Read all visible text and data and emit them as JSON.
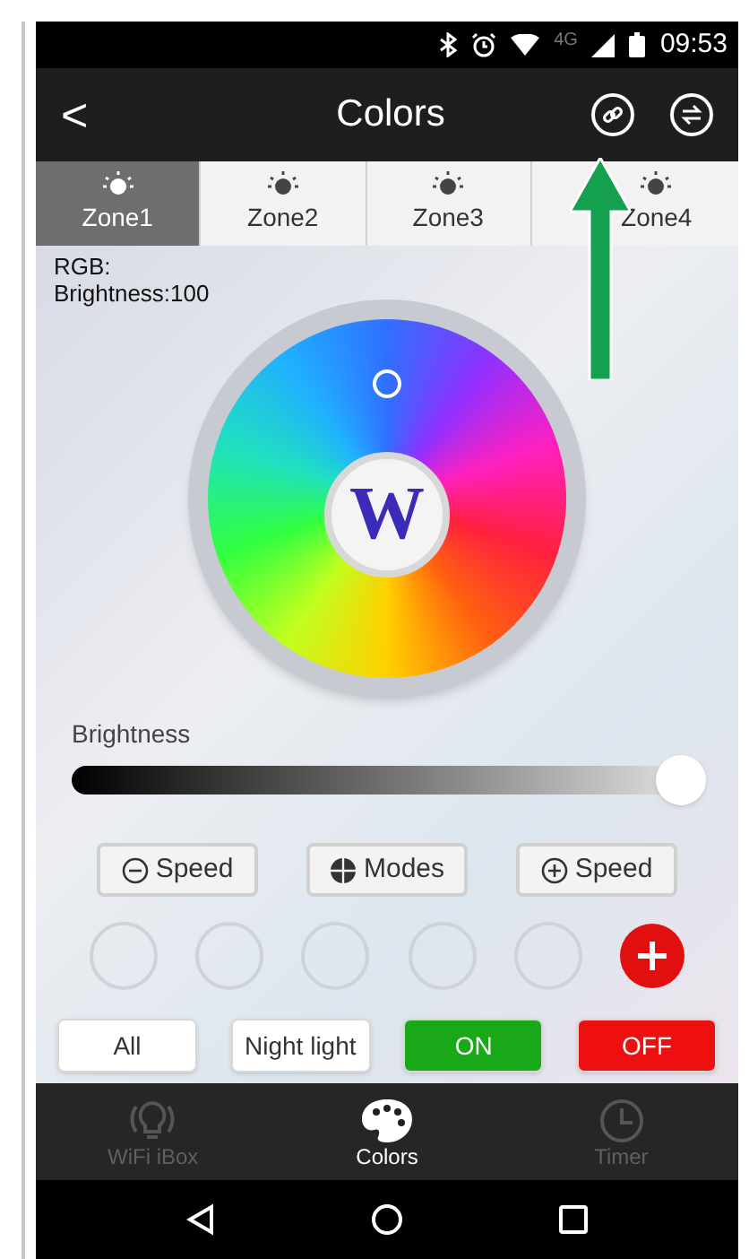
{
  "status_bar": {
    "network": "4G",
    "time": "09:53"
  },
  "title_bar": {
    "back": "<",
    "title": "Colors"
  },
  "zones": [
    {
      "label": "Zone1",
      "selected": true
    },
    {
      "label": "Zone2",
      "selected": false
    },
    {
      "label": "Zone3",
      "selected": false
    },
    {
      "label": "Zone4",
      "selected": false
    }
  ],
  "info": {
    "rgb": "RGB:",
    "brightness": "Brightness:100"
  },
  "brightness": {
    "label": "Brightness",
    "level": 1
  },
  "speed_buttons": [
    {
      "kind": "minus",
      "label": "Speed"
    },
    {
      "kind": "modes",
      "label": "Modes"
    },
    {
      "kind": "plus",
      "label": "Speed"
    }
  ],
  "center_label": "W",
  "actions": [
    {
      "label": "All",
      "kind": "plain"
    },
    {
      "label": "Night light",
      "kind": "plain"
    },
    {
      "label": "ON",
      "kind": "on"
    },
    {
      "label": "OFF",
      "kind": "off"
    }
  ],
  "bottom_nav": [
    {
      "label": "WiFi iBox",
      "selected": false
    },
    {
      "label": "Colors",
      "selected": true
    },
    {
      "label": "Timer",
      "selected": false
    }
  ]
}
